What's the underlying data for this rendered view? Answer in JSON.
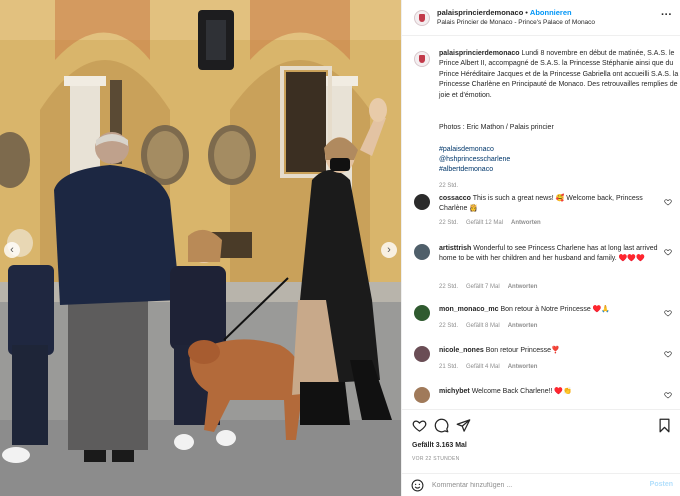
{
  "post": {
    "username": "palaisprincierdemonaco",
    "separator": "•",
    "follow_label": "Abonnieren",
    "location": "Palais Princier de Monaco - Prince's Palace of Monaco",
    "more_icon": "more-icon"
  },
  "caption": {
    "username": "palaisprincierdemonaco",
    "text": "Lundi 8 novembre en début de matinée, S.A.S. le Prince Albert II, accompagné de S.A.S. la Princesse Stéphanie ainsi que du Prince Héréditaire Jacques et de la Princesse Gabriella ont accueilli S.A.S. la Princesse Charlène en Principauté de Monaco. Des retrouvailles remplies de joie et d'émotion.",
    "credit": "Photos : Eric Mathon / Palais princier",
    "tags": [
      "#palaisdemonaco",
      "@hshprincesscharlene",
      "#albertdemonaco"
    ],
    "time": "22 Std."
  },
  "comments": [
    {
      "username": "cossacco",
      "text": "This is such a great news! 🥰 Welcome back, Princess Charlène 👸",
      "time": "22 Std.",
      "likes": "Gefällt 12 Mal",
      "reply": "Antworten",
      "avatar_color": "#2b2b2b"
    },
    {
      "username": "artisttrish",
      "text": "Wonderful to see Princess Charlene has at long last arrived home to be with her children and her husband and family. ♥️♥️♥️",
      "time": "22 Std.",
      "likes": "Gefällt 7 Mal",
      "reply": "Antworten",
      "avatar_color": "#4f5f6a"
    },
    {
      "username": "mon_monaco_mc",
      "text": "Bon retour à Notre Princesse ♥️🙏",
      "time": "22 Std.",
      "likes": "Gefällt 8 Mal",
      "reply": "Antworten",
      "avatar_color": "#2f5a2f"
    },
    {
      "username": "nicole_nones",
      "text": "Bon retour Princesse❣️",
      "time": "21 Std.",
      "likes": "Gefällt 4 Mal",
      "reply": "Antworten",
      "avatar_color": "#6a4d55"
    },
    {
      "username": "michybet",
      "text": "Welcome Back Charlene!! ♥️👏",
      "time": "",
      "likes": "",
      "reply": "",
      "avatar_color": "#a07a5a"
    }
  ],
  "footer": {
    "likes": "Gefällt 3.163 Mal",
    "ago": "VOR 22 STUNDEN",
    "comment_placeholder": "Kommentar hinzufügen ...",
    "post_label": "Posten"
  },
  "photo": {
    "nav_prev": "‹",
    "nav_next": "›"
  },
  "colors": {
    "accent": "#0095f6",
    "link": "#00376b",
    "muted": "#8e8e8e",
    "heart_red": "#ed4956"
  }
}
